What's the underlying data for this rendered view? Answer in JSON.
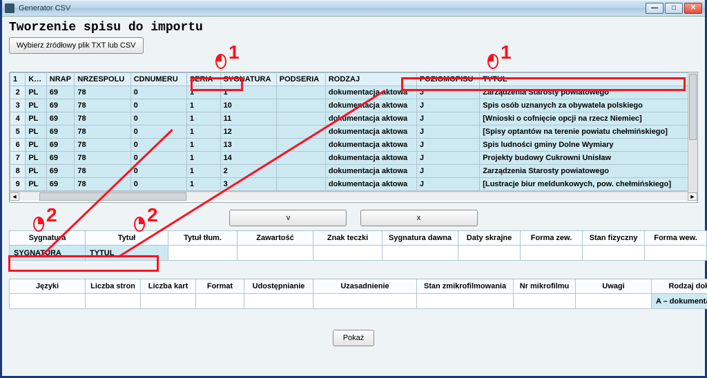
{
  "window": {
    "title": "Generator CSV"
  },
  "heading": "Tworzenie spisu do importu",
  "buttons": {
    "choose_file": "Wybierz źródłowy plik TXT lub CSV",
    "accept": "v",
    "reject": "x",
    "show": "Pokaż"
  },
  "annot": {
    "one": "1",
    "two": "2"
  },
  "grid": {
    "headers": [
      "",
      "KOD",
      "NRAP",
      "NRZESPOLU",
      "CDNUMERU",
      "SERIA",
      "SYGNATURA",
      "PODSERIA",
      "RODZAJ",
      "POZIOMOPISU",
      "TYTUL"
    ],
    "rows": [
      {
        "n": "1",
        "headerRow": true
      },
      {
        "n": "2",
        "kod": "PL",
        "nrap": "69",
        "nrz": "78",
        "cdn": "0",
        "ser": "1",
        "syg": "1",
        "pod": "",
        "rod": "dokumentacja aktowa",
        "poz": "J",
        "tyt": "Zarządzenia Starosty powiatowego"
      },
      {
        "n": "3",
        "kod": "PL",
        "nrap": "69",
        "nrz": "78",
        "cdn": "0",
        "ser": "1",
        "syg": "10",
        "pod": "",
        "rod": "dokumentacja aktowa",
        "poz": "J",
        "tyt": "Spis osób uznanych za obywatela polskiego"
      },
      {
        "n": "4",
        "kod": "PL",
        "nrap": "69",
        "nrz": "78",
        "cdn": "0",
        "ser": "1",
        "syg": "11",
        "pod": "",
        "rod": "dokumentacja aktowa",
        "poz": "J",
        "tyt": "[Wnioski o cofnięcie opcji na rzecz Niemiec]"
      },
      {
        "n": "5",
        "kod": "PL",
        "nrap": "69",
        "nrz": "78",
        "cdn": "0",
        "ser": "1",
        "syg": "12",
        "pod": "",
        "rod": "dokumentacja aktowa",
        "poz": "J",
        "tyt": "[Spisy optantów na terenie powiatu chełmińskiego]"
      },
      {
        "n": "6",
        "kod": "PL",
        "nrap": "69",
        "nrz": "78",
        "cdn": "0",
        "ser": "1",
        "syg": "13",
        "pod": "",
        "rod": "dokumentacja aktowa",
        "poz": "J",
        "tyt": "Spis ludności gminy Dolne Wymiary"
      },
      {
        "n": "7",
        "kod": "PL",
        "nrap": "69",
        "nrz": "78",
        "cdn": "0",
        "ser": "1",
        "syg": "14",
        "pod": "",
        "rod": "dokumentacja aktowa",
        "poz": "J",
        "tyt": "Projekty budowy Cukrowni Unisław"
      },
      {
        "n": "8",
        "kod": "PL",
        "nrap": "69",
        "nrz": "78",
        "cdn": "0",
        "ser": "1",
        "syg": "2",
        "pod": "",
        "rod": "dokumentacja aktowa",
        "poz": "J",
        "tyt": "Zarządzenia Starosty powiatowego"
      },
      {
        "n": "9",
        "kod": "PL",
        "nrap": "69",
        "nrz": "78",
        "cdn": "0",
        "ser": "1",
        "syg": "3",
        "pod": "",
        "rod": "dokumentacja aktowa",
        "poz": "J",
        "tyt": "[Lustracje biur meldunkowych, pow. chełmińskiego]"
      }
    ]
  },
  "map1": {
    "headers": [
      "Sygnatura",
      "Tytuł",
      "Tytuł tłum.",
      "Zawartość",
      "Znak teczki",
      "Sygnatura dawna",
      "Daty skrajne",
      "Forma zew.",
      "Stan fizyczny",
      "Forma wew."
    ],
    "values": [
      "SYGNATURA",
      "TYTUL",
      "",
      "",
      "",
      "",
      "",
      "",
      "",
      ""
    ]
  },
  "map2": {
    "headers": [
      "Języki",
      "Liczba stron",
      "Liczba kart",
      "Format",
      "Udostępnianie",
      "Uzasadnienie",
      "Stan zmikrofilmowania",
      "Nr mikrofilmu",
      "Uwagi",
      "Rodzaj dokumentacji"
    ],
    "values": [
      "",
      "",
      "",
      "",
      "",
      "",
      "",
      "",
      "",
      "A – dokumentacja aktowa"
    ]
  }
}
